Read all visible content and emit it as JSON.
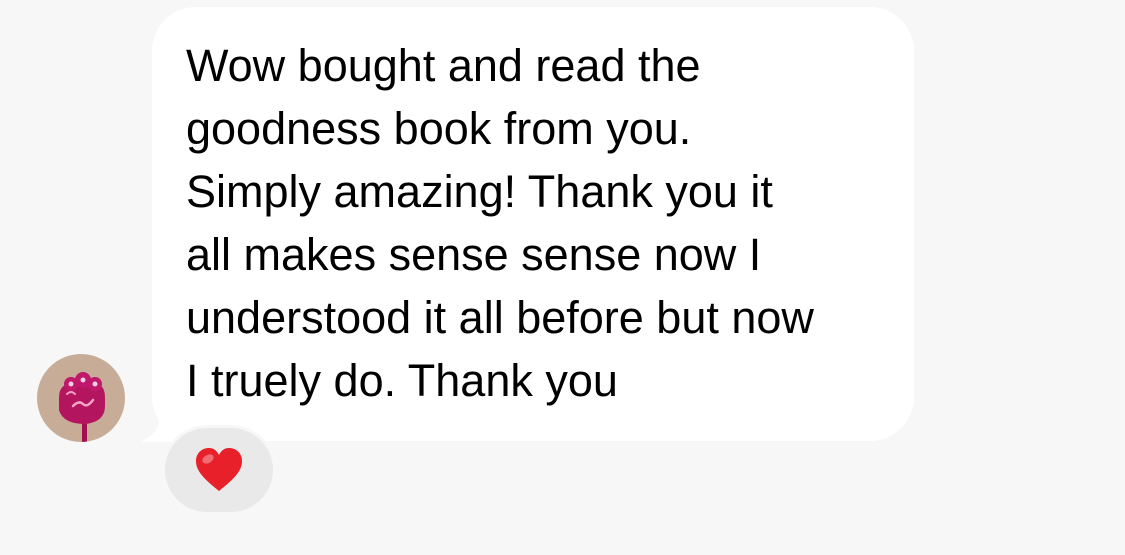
{
  "message": {
    "text": "Wow bought and read the\ngoodness book from you.\nSimply amazing!  Thank you it\nall makes sense sense now I\nunderstood it all before but now\nI truely do. Thank you"
  },
  "avatar": {
    "icon": "flower-icon",
    "background_color": "#c7ad97",
    "accent_color": "#b3155f"
  },
  "reaction": {
    "emoji": "heart-icon",
    "color": "#e8202a"
  },
  "colors": {
    "background": "#f7f7f7",
    "bubble": "#ffffff",
    "reaction_pill": "#e9e9e9"
  }
}
